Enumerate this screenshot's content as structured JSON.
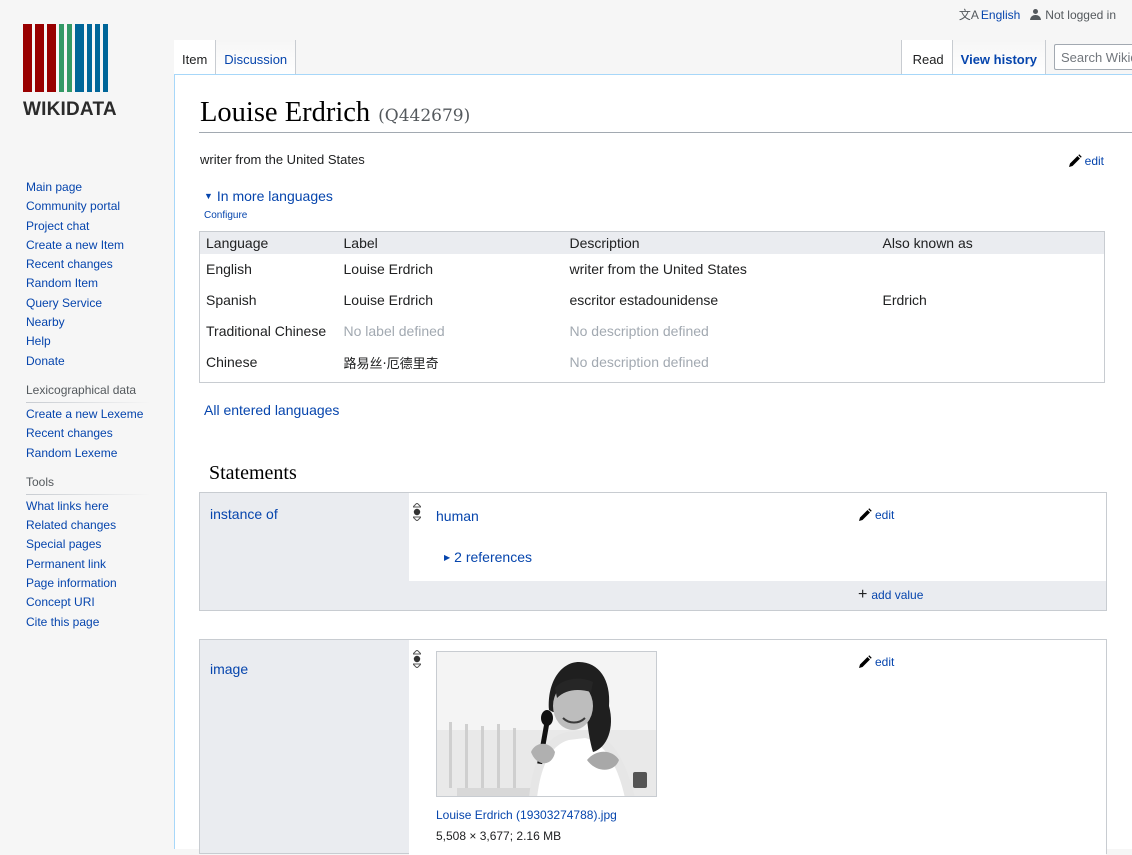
{
  "personal": {
    "language": "English",
    "user_status": "Not logged in"
  },
  "logo": {
    "wordmark": "WIKIDATA",
    "bar_colors": [
      "#990000",
      "#990000",
      "#990000",
      "#339966",
      "#339966",
      "#006699",
      "#006699",
      "#006699",
      "#006699"
    ]
  },
  "sidebar": {
    "nav": [
      "Main page",
      "Community portal",
      "Project chat",
      "Create a new Item",
      "Recent changes",
      "Random Item",
      "Query Service",
      "Nearby",
      "Help",
      "Donate"
    ],
    "lexeme_heading": "Lexicographical data",
    "lexeme": [
      "Create a new Lexeme",
      "Recent changes",
      "Random Lexeme"
    ],
    "tools_heading": "Tools",
    "tools": [
      "What links here",
      "Related changes",
      "Special pages",
      "Permanent link",
      "Page information",
      "Concept URI",
      "Cite this page"
    ]
  },
  "tabs": {
    "item": "Item",
    "discussion": "Discussion",
    "read": "Read",
    "history": "View history",
    "search_placeholder": "Search Wikidata"
  },
  "entity": {
    "label": "Louise Erdrich",
    "id": "(Q442679)",
    "description": "writer from the United States",
    "edit": "edit"
  },
  "languages": {
    "toggle": "In more languages",
    "configure": "Configure",
    "headers": [
      "Language",
      "Label",
      "Description",
      "Also known as"
    ],
    "rows": [
      {
        "language": "English",
        "label": "Louise Erdrich",
        "description": "writer from the United States",
        "aliases": ""
      },
      {
        "language": "Spanish",
        "label": "Louise Erdrich",
        "description": "escritor estadounidense",
        "aliases": "Erdrich"
      },
      {
        "language": "Traditional Chinese",
        "label": "No label defined",
        "description": "No description defined",
        "aliases": ""
      },
      {
        "language": "Chinese",
        "label": "路易丝·厄德里奇",
        "description": "No description defined",
        "aliases": ""
      }
    ],
    "all_link": "All entered languages"
  },
  "statements": {
    "heading": "Statements",
    "instance_of": {
      "property": "instance of",
      "value": "human",
      "references": "2 references",
      "edit": "edit",
      "add_value": "add value"
    },
    "image": {
      "property": "image",
      "file": "Louise Erdrich (19303274788).jpg",
      "meta": "5,508 × 3,677; 2.16 MB",
      "edit": "edit"
    }
  },
  "colors": {
    "link": "#0645ad",
    "border": "#c8ccd1",
    "header_bg": "#eaecf0",
    "tab_border": "#a7d7f9"
  }
}
